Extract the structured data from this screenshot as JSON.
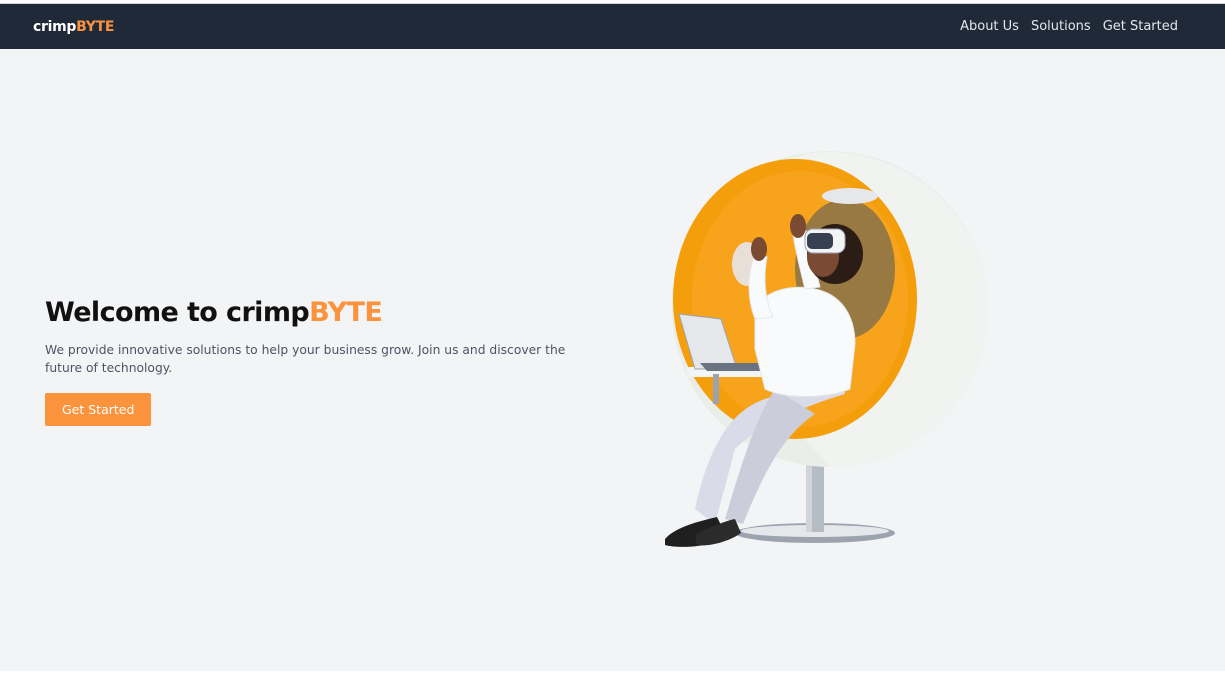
{
  "navbar": {
    "logo_prefix": "crimp",
    "logo_accent": "BYTE",
    "links": [
      {
        "label": "About Us"
      },
      {
        "label": "Solutions"
      },
      {
        "label": "Get Started"
      }
    ]
  },
  "hero": {
    "title_prefix": "Welcome to crimp",
    "title_accent": "BYTE",
    "description": "We provide innovative solutions to help your business grow. Join us and discover the future of technology.",
    "cta_label": "Get Started",
    "image_icon": "woman-vr-egg-chair-illustration"
  },
  "colors": {
    "navbar_bg": "#1f2937",
    "accent": "#fb923c",
    "page_bg": "#f3f4f6"
  }
}
